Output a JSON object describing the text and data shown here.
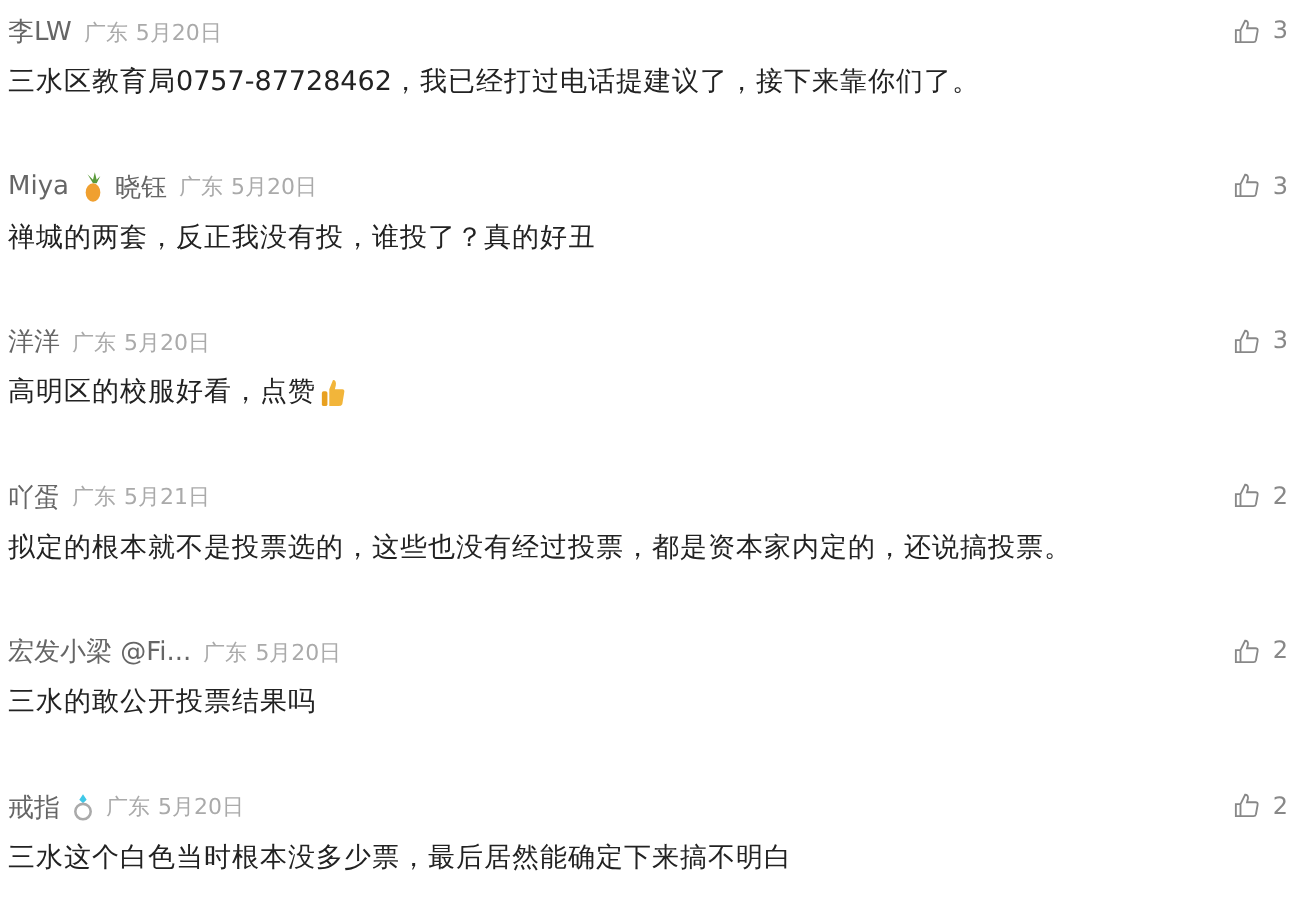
{
  "comments": [
    {
      "author": "李LW",
      "location": "广东",
      "date": "5月20日",
      "text": "三水区教育局0757-87728462，我已经打过电话提建议了，接下来靠你们了。",
      "likes": "3"
    },
    {
      "author": "Miya",
      "badge": {
        "kind": "pineapple"
      },
      "author_extra": "晓钰",
      "location": "广东",
      "date": "5月20日",
      "text": "禅城的两套，反正我没有投，谁投了？真的好丑",
      "likes": "3"
    },
    {
      "author": "洋洋",
      "location": "广东",
      "date": "5月20日",
      "text": "高明区的校服好看，点赞",
      "text_emoji": {
        "kind": "thumbs-up"
      },
      "likes": "3"
    },
    {
      "author": "吖蛋",
      "location": "广东",
      "date": "5月21日",
      "text": "拟定的根本就不是投票选的，这些也没有经过投票，都是资本家内定的，还说搞投票。",
      "likes": "2"
    },
    {
      "author": "宏发小梁 @Fi...",
      "location": "广东",
      "date": "5月20日",
      "text": "三水的敢公开投票结果吗",
      "likes": "2"
    },
    {
      "author": "戒指",
      "badge": {
        "kind": "ring"
      },
      "location": "广东",
      "date": "5月20日",
      "text": "三水这个白色当时根本没多少票，最后居然能确定下来搞不明白",
      "likes": "2"
    }
  ]
}
